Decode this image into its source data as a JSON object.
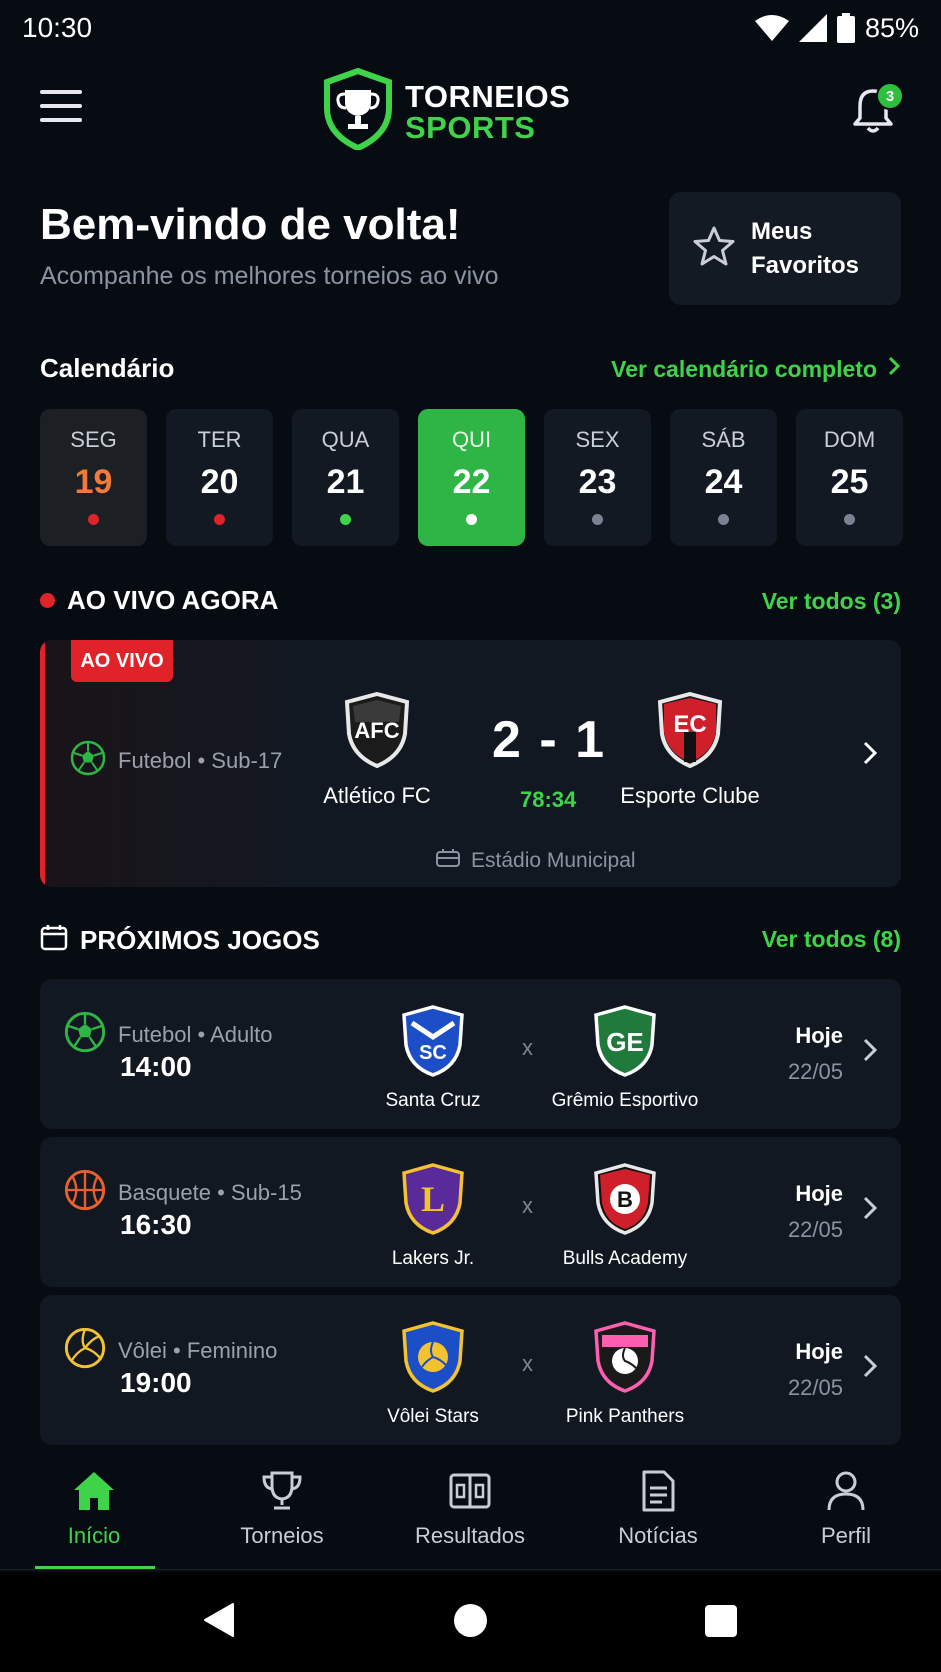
{
  "status_bar": {
    "time": "10:30",
    "battery": "85%"
  },
  "header": {
    "logo_line1": "TORNEIOS",
    "logo_line2": "SPORTS",
    "notification_count": "3"
  },
  "welcome": {
    "title": "Bem-vindo de volta!",
    "subtitle": "Acompanhe os melhores torneios ao vivo"
  },
  "favorites": {
    "label": "Meus Favoritos"
  },
  "calendar": {
    "title": "Calendário",
    "link": "Ver calendário completo",
    "days": [
      {
        "name": "SEG",
        "num": "19",
        "dot": "#e0232a",
        "state": "today"
      },
      {
        "name": "TER",
        "num": "20",
        "dot": "#e0232a",
        "state": "normal"
      },
      {
        "name": "QUA",
        "num": "21",
        "dot": "#3fd34a",
        "state": "normal"
      },
      {
        "name": "QUI",
        "num": "22",
        "dot": "#ffffff",
        "state": "selected"
      },
      {
        "name": "SEX",
        "num": "23",
        "dot": "#7a8394",
        "state": "normal"
      },
      {
        "name": "SÁB",
        "num": "24",
        "dot": "#7a8394",
        "state": "normal"
      },
      {
        "name": "DOM",
        "num": "25",
        "dot": "#7a8394",
        "state": "normal"
      }
    ]
  },
  "live": {
    "title": "AO VIVO AGORA",
    "link": "Ver todos (3)",
    "badge": "AO VIVO",
    "sport": "Futebol • Sub-17",
    "home_team": "Atlético FC",
    "home_abbr": "AFC",
    "away_team": "Esporte Clube",
    "away_abbr": "EC",
    "score": "2 - 1",
    "minute": "78:34",
    "venue": "Estádio Municipal"
  },
  "upcoming": {
    "title": "PRÓXIMOS JOGOS",
    "link": "Ver todos (8)",
    "vs": "x",
    "matches": [
      {
        "sport": "Futebol • Adulto",
        "time": "14:00",
        "home": "Santa Cruz",
        "home_abbr": "SC",
        "away": "Grêmio Esportivo",
        "away_abbr": "GE",
        "day": "Hoje",
        "date": "22/05",
        "sport_icon": "soccer-ball-icon"
      },
      {
        "sport": "Basquete • Sub-15",
        "time": "16:30",
        "home": "Lakers Jr.",
        "home_abbr": "L",
        "away": "Bulls Academy",
        "away_abbr": "B",
        "day": "Hoje",
        "date": "22/05",
        "sport_icon": "basketball-icon"
      },
      {
        "sport": "Vôlei • Feminino",
        "time": "19:00",
        "home": "Vôlei Stars",
        "home_abbr": "",
        "away": "Pink Panthers",
        "away_abbr": "",
        "day": "Hoje",
        "date": "22/05",
        "sport_icon": "volleyball-icon"
      }
    ]
  },
  "bottom_nav": {
    "items": [
      {
        "label": "Início",
        "icon": "home-icon",
        "active": true
      },
      {
        "label": "Torneios",
        "icon": "trophy-icon"
      },
      {
        "label": "Resultados",
        "icon": "scoreboard-icon"
      },
      {
        "label": "Notícias",
        "icon": "news-icon"
      },
      {
        "label": "Perfil",
        "icon": "profile-icon"
      }
    ]
  },
  "colors": {
    "accent": "#3fd34a",
    "live": "#e0232a",
    "background": "#070b12",
    "card": "#121822"
  }
}
